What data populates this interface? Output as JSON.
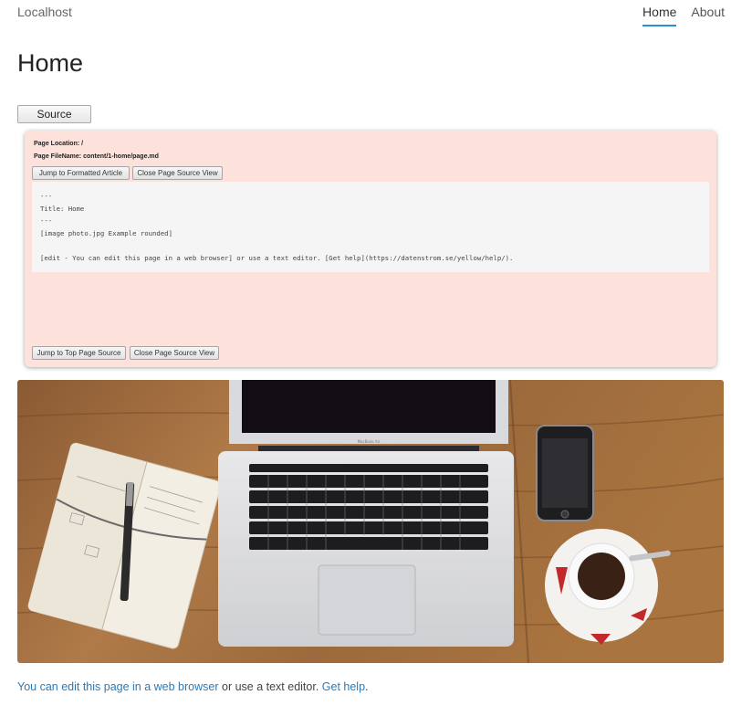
{
  "header": {
    "site_name": "Localhost",
    "nav": [
      {
        "label": "Home",
        "active": true
      },
      {
        "label": "About",
        "active": false
      }
    ]
  },
  "main": {
    "title": "Home",
    "source_button_label": "Source"
  },
  "source_view": {
    "page_location": "Page Location: /",
    "page_filename": "Page FileName: content/1-home/page.md",
    "jump_formatted_label": "Jump to Formatted Article",
    "close_label": "Close Page Source View",
    "jump_top_label": "Jump to Top Page Source",
    "source_text": "---\nTitle: Home\n---\n[image photo.jpg Example rounded]\n\n[edit - You can edit this page in a web browser] or use a text editor. [Get help](https://datenstrom.se/yellow/help/)."
  },
  "photo": {
    "laptop_brand": "MacBook Air"
  },
  "footer": {
    "edit_link": "You can edit this page in a web browser",
    "middle_text": " or use a text editor. ",
    "help_link": "Get help",
    "end_text": "."
  },
  "colors": {
    "accent": "#2a8fce",
    "link": "#2a7ab9",
    "source_panel_bg": "#fde1db"
  }
}
